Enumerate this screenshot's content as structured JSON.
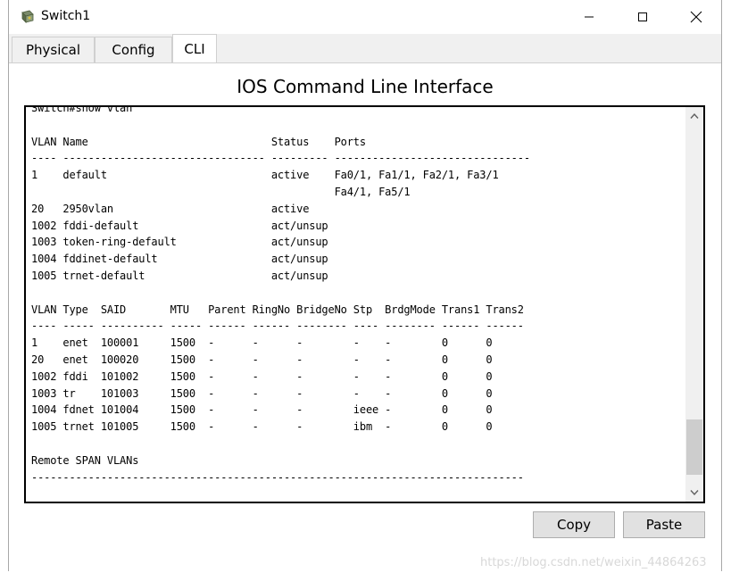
{
  "window": {
    "title": "Switch1",
    "app_icon": "switch-device-icon",
    "controls": {
      "minimize": "minimize-icon",
      "maximize": "maximize-icon",
      "close": "close-icon"
    }
  },
  "tabs": [
    {
      "label": "Physical",
      "active": false
    },
    {
      "label": "Config",
      "active": false
    },
    {
      "label": "CLI",
      "active": true
    }
  ],
  "cli": {
    "heading": "IOS Command Line Interface",
    "console_output": "Switch#show vlan\n\nVLAN Name                             Status    Ports\n---- -------------------------------- --------- -------------------------------\n1    default                          active    Fa0/1, Fa1/1, Fa2/1, Fa3/1\n                                                Fa4/1, Fa5/1\n20   2950vlan                         active\n1002 fddi-default                     act/unsup\n1003 token-ring-default               act/unsup\n1004 fddinet-default                  act/unsup\n1005 trnet-default                    act/unsup\n\nVLAN Type  SAID       MTU   Parent RingNo BridgeNo Stp  BrdgMode Trans1 Trans2\n---- ----- ---------- ----- ------ ------ -------- ---- -------- ------ ------\n1    enet  100001     1500  -      -      -        -    -        0      0\n20   enet  100020     1500  -      -      -        -    -        0      0\n1002 fddi  101002     1500  -      -      -        -    -        0      0\n1003 tr    101003     1500  -      -      -        -    -        0      0\n1004 fdnet 101004     1500  -      -      -        ieee -        0      0\n1005 trnet 101005     1500  -      -      -        ibm  -        0      0\n\nRemote SPAN VLANs\n------------------------------------------------------------------------------",
    "copy_label": "Copy",
    "paste_label": "Paste"
  },
  "watermark": "https://blog.csdn.net/weixin_44864263",
  "colors": {
    "tab_background": "#f0f0f0",
    "button_background": "#e1e1e1",
    "console_border": "#000000"
  }
}
